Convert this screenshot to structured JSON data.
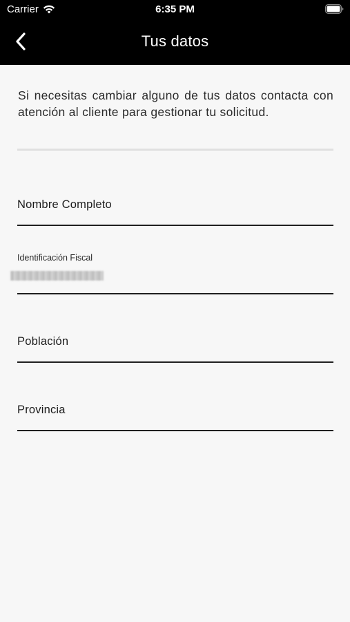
{
  "status_bar": {
    "carrier": "Carrier",
    "time": "6:35 PM",
    "wifi_icon": "wifi-icon",
    "battery_icon": "battery-icon"
  },
  "nav": {
    "title": "Tus datos",
    "back_icon": "chevron-left-icon"
  },
  "notice": {
    "text": "Si necesitas cambiar alguno de tus datos contacta con atención al cliente para gestionar tu solicitud."
  },
  "form": {
    "full_name": {
      "placeholder": "Nombre Completo",
      "value": ""
    },
    "tax_id": {
      "label": "Identificación Fiscal"
    },
    "town": {
      "placeholder": "Población",
      "value": ""
    },
    "province": {
      "placeholder": "Provincia",
      "value": ""
    }
  },
  "colors": {
    "header_background": "#000000",
    "page_background": "#f7f7f7",
    "text": "#1c1c1c",
    "divider": "#e0e0e0"
  }
}
